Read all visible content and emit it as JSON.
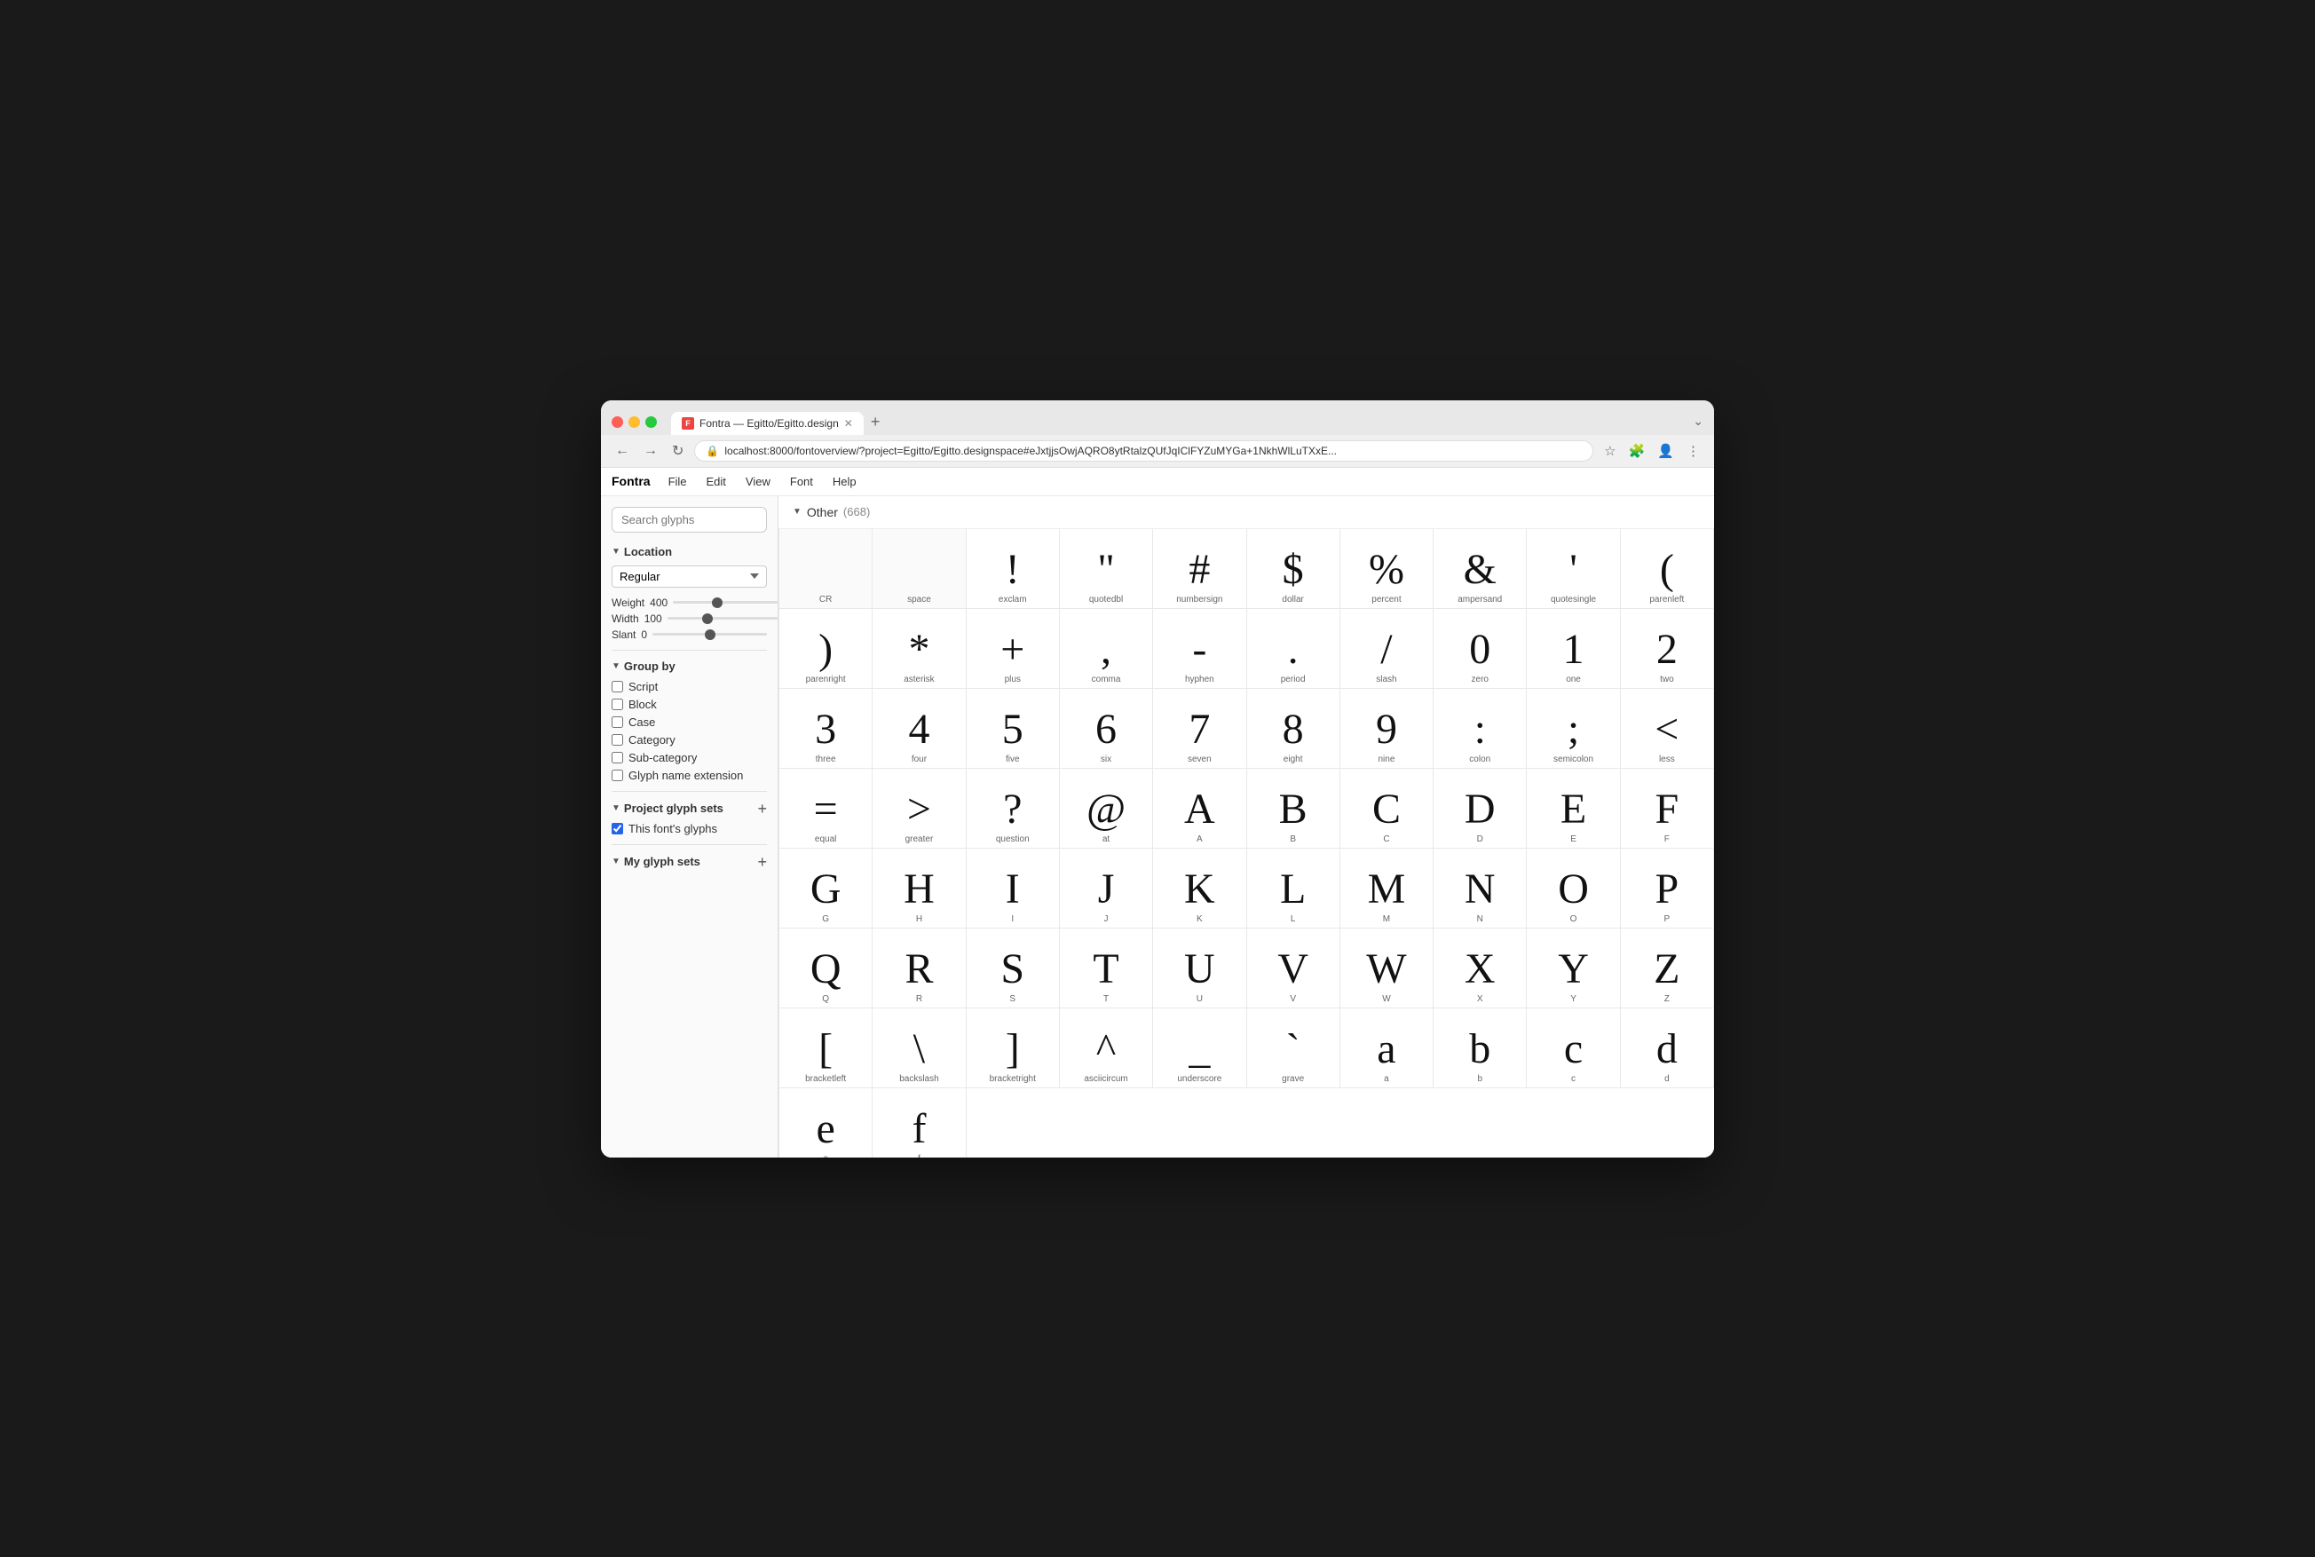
{
  "browser": {
    "tab_title": "Fontra — Egitto/Egitto.design",
    "url": "localhost:8000/fontoverview/?project=Egitto/Egitto.designspace#eJxtjjsOwjAQRO8ytRtalzQUfJqIClFYZuMYGa+1NkhWlLuTXxE...",
    "favicon_label": "F",
    "new_tab_label": "+",
    "expand_icon": "⌄"
  },
  "menu": {
    "brand": "Fontra",
    "items": [
      "File",
      "Edit",
      "View",
      "Font",
      "Help"
    ]
  },
  "sidebar": {
    "search_placeholder": "Search glyphs",
    "location_section": "Location",
    "location_value": "Regular",
    "weight_label": "Weight",
    "weight_value": "400",
    "width_label": "Width",
    "width_value": "100",
    "slant_label": "Slant",
    "slant_value": "0",
    "group_by_label": "Group by",
    "group_options": [
      {
        "label": "Script",
        "checked": false
      },
      {
        "label": "Block",
        "checked": false
      },
      {
        "label": "Case",
        "checked": false
      },
      {
        "label": "Category",
        "checked": false
      },
      {
        "label": "Sub-category",
        "checked": false
      },
      {
        "label": "Glyph name extension",
        "checked": false
      }
    ],
    "project_glyph_sets_label": "Project glyph sets",
    "my_glyph_sets_label": "My glyph sets",
    "fonts_glyphs_label": "This font's glyphs",
    "fonts_glyphs_checked": true
  },
  "glyph_area": {
    "group_name": "Other",
    "group_count": "668",
    "glyphs": [
      {
        "char": "",
        "name": "CR",
        "empty": true
      },
      {
        "char": " ",
        "name": "space",
        "empty": true
      },
      {
        "char": "!",
        "name": "exclam"
      },
      {
        "char": "\"",
        "name": "quotedbl"
      },
      {
        "char": "#",
        "name": "numbersign"
      },
      {
        "char": "$",
        "name": "dollar"
      },
      {
        "char": "%",
        "name": "percent"
      },
      {
        "char": "&",
        "name": "ampersand"
      },
      {
        "char": "'",
        "name": "quotesingle"
      },
      {
        "char": "(",
        "name": "parenleft"
      },
      {
        "char": ")",
        "name": "parenright"
      },
      {
        "char": "*",
        "name": "asterisk"
      },
      {
        "char": "+",
        "name": "plus"
      },
      {
        "char": ",",
        "name": "comma"
      },
      {
        "char": "-",
        "name": "hyphen"
      },
      {
        "char": ".",
        "name": "period"
      },
      {
        "char": "/",
        "name": "slash"
      },
      {
        "char": "0",
        "name": "zero"
      },
      {
        "char": "1",
        "name": "one"
      },
      {
        "char": "2",
        "name": "two"
      },
      {
        "char": "3",
        "name": "three"
      },
      {
        "char": "4",
        "name": "four"
      },
      {
        "char": "5",
        "name": "five"
      },
      {
        "char": "6",
        "name": "six"
      },
      {
        "char": "7",
        "name": "seven"
      },
      {
        "char": "8",
        "name": "eight"
      },
      {
        "char": "9",
        "name": "nine"
      },
      {
        "char": ":",
        "name": "colon"
      },
      {
        "char": ";",
        "name": "semicolon"
      },
      {
        "char": "<",
        "name": "less"
      },
      {
        "char": "=",
        "name": "equal"
      },
      {
        "char": ">",
        "name": "greater"
      },
      {
        "char": "?",
        "name": "question"
      },
      {
        "char": "@",
        "name": "at"
      },
      {
        "char": "A",
        "name": "A"
      },
      {
        "char": "B",
        "name": "B"
      },
      {
        "char": "C",
        "name": "C"
      },
      {
        "char": "D",
        "name": "D"
      },
      {
        "char": "E",
        "name": "E"
      },
      {
        "char": "F",
        "name": "F"
      },
      {
        "char": "G",
        "name": "G"
      },
      {
        "char": "H",
        "name": "H"
      },
      {
        "char": "I",
        "name": "I"
      },
      {
        "char": "J",
        "name": "J"
      },
      {
        "char": "K",
        "name": "K"
      },
      {
        "char": "L",
        "name": "L"
      },
      {
        "char": "M",
        "name": "M"
      },
      {
        "char": "N",
        "name": "N"
      },
      {
        "char": "O",
        "name": "O"
      },
      {
        "char": "P",
        "name": "P"
      },
      {
        "char": "Q",
        "name": "Q"
      },
      {
        "char": "R",
        "name": "R"
      },
      {
        "char": "S",
        "name": "S"
      },
      {
        "char": "T",
        "name": "T"
      },
      {
        "char": "U",
        "name": "U"
      },
      {
        "char": "V",
        "name": "V"
      },
      {
        "char": "W",
        "name": "W"
      },
      {
        "char": "X",
        "name": "X"
      },
      {
        "char": "Y",
        "name": "Y"
      },
      {
        "char": "Z",
        "name": "Z"
      },
      {
        "char": "[",
        "name": "bracketleft"
      },
      {
        "char": "\\",
        "name": "backslash"
      },
      {
        "char": "]",
        "name": "bracketright"
      },
      {
        "char": "^",
        "name": "asciicircum"
      },
      {
        "char": "_",
        "name": "underscore"
      },
      {
        "char": "`",
        "name": "grave"
      },
      {
        "char": "a",
        "name": "a",
        "partial": true
      },
      {
        "char": "b",
        "name": "b",
        "partial": true
      },
      {
        "char": "c",
        "name": "c",
        "partial": true
      },
      {
        "char": "d",
        "name": "d",
        "partial": true
      },
      {
        "char": "e",
        "name": "e",
        "partial": true
      },
      {
        "char": "f",
        "name": "f",
        "partial": true
      }
    ]
  }
}
